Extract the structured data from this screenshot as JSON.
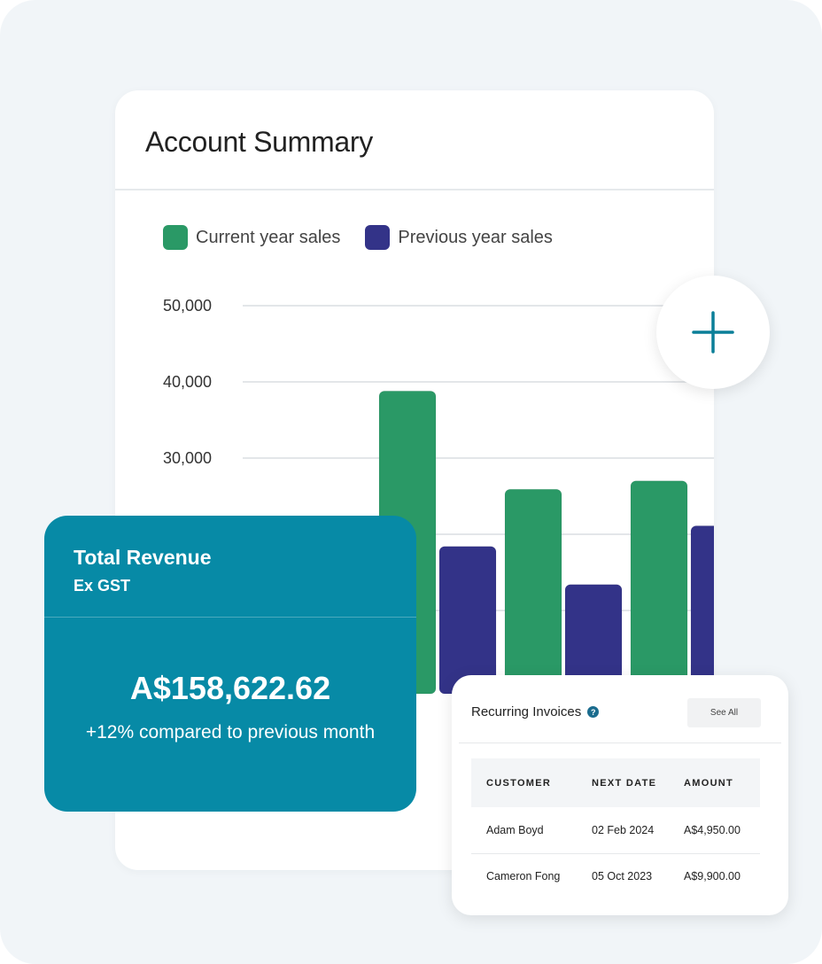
{
  "summary": {
    "title": "Account Summary",
    "legend": [
      {
        "label": "Current year sales",
        "color": "#2a9966"
      },
      {
        "label": "Previous year sales",
        "color": "#333388"
      }
    ]
  },
  "chart_data": {
    "type": "bar",
    "title": "Account Summary",
    "xlabel": "",
    "ylabel": "",
    "ylim": [
      0,
      50000
    ],
    "y_ticks": [
      "30,000",
      "40,000",
      "50,000"
    ],
    "grid": true,
    "legend_position": "top-left",
    "series": [
      {
        "name": "Current year sales",
        "color": "#2a9966",
        "values": [
          38800,
          25900,
          27000
        ]
      },
      {
        "name": "Previous year sales",
        "color": "#333388",
        "values": [
          18400,
          13400,
          21100
        ]
      }
    ]
  },
  "plus_button": {
    "icon": "plus-icon",
    "color": "#0b7f98"
  },
  "revenue": {
    "title": "Total Revenue",
    "subtitle": "Ex GST",
    "amount": "A$158,622.62",
    "comparison": "+12% compared to previous month",
    "color": "#078aa6"
  },
  "invoices": {
    "title": "Recurring Invoices",
    "help_icon": "?",
    "see_all_label": "See All",
    "columns": [
      "CUSTOMER",
      "NEXT DATE",
      "AMOUNT"
    ],
    "rows": [
      {
        "customer": "Adam Boyd",
        "next_date": "02 Feb 2024",
        "amount": "A$4,950.00"
      },
      {
        "customer": "Cameron Fong",
        "next_date": "05 Oct 2023",
        "amount": "A$9,900.00"
      }
    ]
  }
}
